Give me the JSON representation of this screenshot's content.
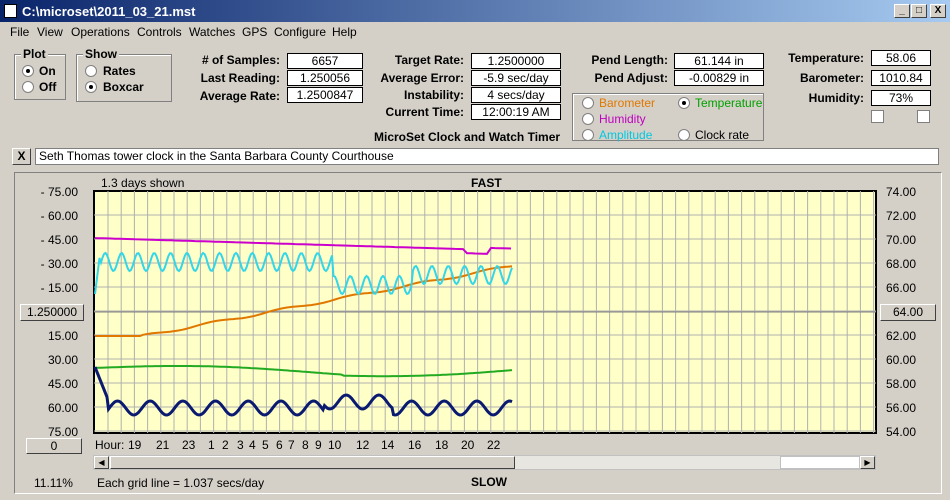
{
  "window": {
    "title": "C:\\microset\\2011_03_21.mst",
    "min": "_",
    "max": "□",
    "close": "X"
  },
  "menu": [
    "File",
    "View",
    "Operations",
    "Controls",
    "Watches",
    "GPS",
    "Configure",
    "Help"
  ],
  "plot": {
    "title": "Plot",
    "on": "On",
    "off": "Off",
    "selected": "On"
  },
  "show": {
    "title": "Show",
    "rates": "Rates",
    "boxcar": "Boxcar",
    "selected": "Boxcar"
  },
  "stats": {
    "samples_label": "# of Samples:",
    "samples": "6657",
    "last_label": "Last Reading:",
    "last": "1.250056",
    "avg_rate_label": "Average Rate:",
    "avg_rate": "1.2500847",
    "target_label": "Target Rate:",
    "target": "1.2500000",
    "avg_err_label": "Average Error:",
    "avg_err": "-5.9 sec/day",
    "instab_label": "Instability:",
    "instab": "4 secs/day",
    "time_label": "Current Time:",
    "time": "12:00:19 AM",
    "pend_len_label": "Pend Length:",
    "pend_len": "61.144 in",
    "pend_adj_label": "Pend Adjust:",
    "pend_adj": "-0.00829 in",
    "temp_label": "Temperature:",
    "temp": "58.06",
    "baro_label": "Barometer:",
    "baro": "1010.84",
    "hum_label": "Humidity:",
    "hum": "73%"
  },
  "subtitle": "MicroSet Clock and Watch Timer",
  "sensors": {
    "barometer": "Barometer",
    "temperature": "Temperature",
    "humidity": "Humidity",
    "amplitude": "Amplitude",
    "clockrate": "Clock rate",
    "selected": "Temperature",
    "colors": {
      "barometer": "#e07800",
      "temperature": "#00a000",
      "humidity": "#c000c0",
      "amplitude": "#00c8e0"
    }
  },
  "note": {
    "close": "X",
    "text": "Seth Thomas tower clock in the Santa Barbara County Courthouse"
  },
  "graph": {
    "days_shown": "1.3 days shown",
    "fast": "FAST",
    "slow": "SLOW",
    "left_labels": [
      "- 75.00",
      "- 60.00",
      "- 45.00",
      "- 30.00",
      "- 15.00",
      "15.00",
      "30.00",
      "45.00",
      "60.00",
      "75.00"
    ],
    "center_left": "1.250000",
    "right_labels": [
      "74.00",
      "72.00",
      "70.00",
      "68.00",
      "66.00",
      "62.00",
      "60.00",
      "58.00",
      "56.00",
      "54.00"
    ],
    "center_right": "64.00",
    "hour_label": "Hour:",
    "hours": [
      "19",
      "21",
      "23",
      "1",
      "2",
      "3",
      "4",
      "5",
      "6",
      "7",
      "8",
      "9",
      "10",
      "12",
      "14",
      "16",
      "18",
      "20",
      "22"
    ],
    "zero_btn": "0",
    "percent": "11.11%",
    "grid_note": "Each grid line = 1.037 secs/day",
    "plot_bg": "#ffffc8"
  }
}
